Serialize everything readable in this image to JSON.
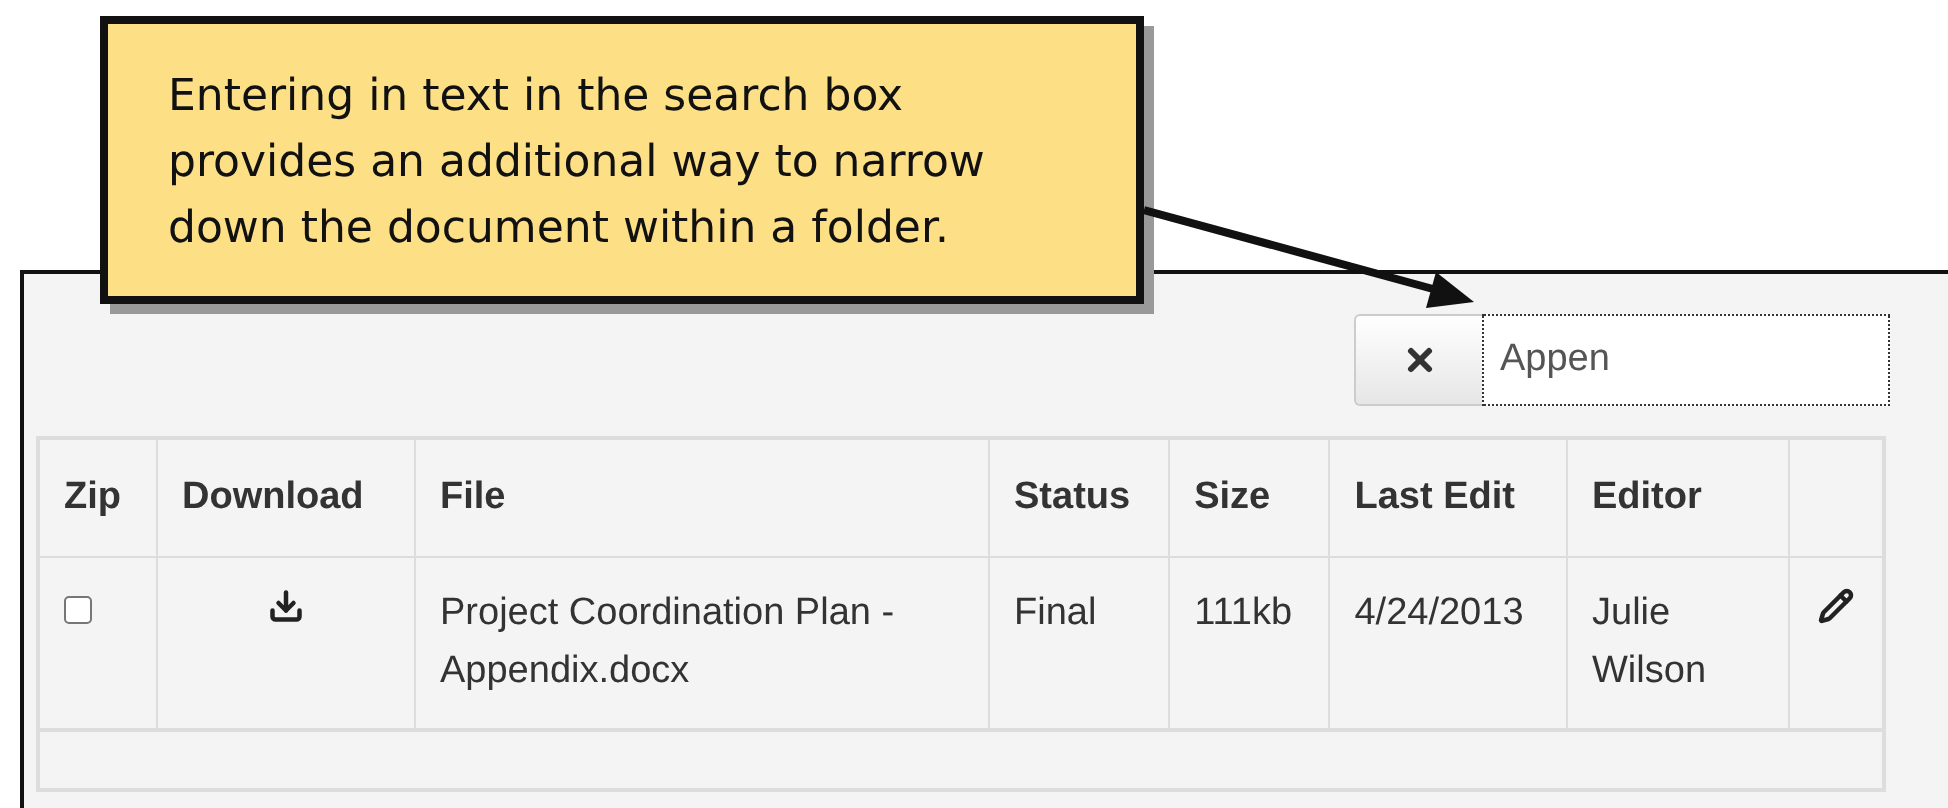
{
  "callout": {
    "text": "Entering in text in the search box provides an additional way to narrow down the document within a folder."
  },
  "search": {
    "value": "Appen"
  },
  "table": {
    "columns": [
      "Zip",
      "Download",
      "File",
      "Status",
      "Size",
      "Last Edit",
      "Editor"
    ],
    "rows": [
      {
        "checked": false,
        "file": "Project Coordination Plan - Appendix.docx",
        "status": "Final",
        "size": "111kb",
        "last_edit": "4/24/2013",
        "editor": "Julie Wilson"
      }
    ]
  }
}
